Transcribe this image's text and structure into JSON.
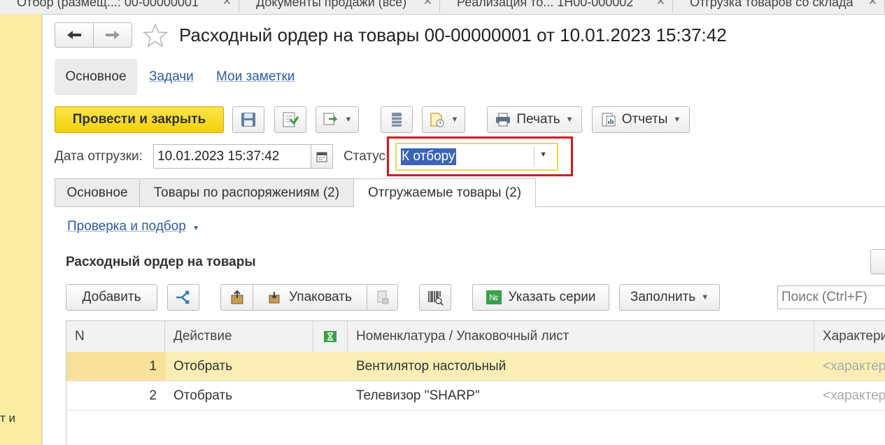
{
  "top_tabs": [
    {
      "label": "Отбор (размещ...: 00-00000001"
    },
    {
      "label": "Документы продажи (все)"
    },
    {
      "label": "Реализация то... 1Н00-000002"
    },
    {
      "label": "Отгрузка товаров со склада"
    }
  ],
  "left_panel": {
    "fragment": "т и"
  },
  "window": {
    "title": "Расходный ордер на товары 00-00000001 от 10.01.2023 15:37:42",
    "nav": {
      "back_icon": "arrow-left-icon",
      "forward_icon": "arrow-right-icon",
      "favorite_icon": "star-icon"
    }
  },
  "subnav": [
    {
      "label": "Основное",
      "active": true
    },
    {
      "label": "Задачи",
      "active": false
    },
    {
      "label": "Мои заметки",
      "active": false
    }
  ],
  "toolbar": {
    "post_close": "Провести и закрыть",
    "print": "Печать",
    "reports": "Отчеты",
    "accent_color": "#f8d90f"
  },
  "fields": {
    "ship_date_label": "Дата отгрузки:",
    "ship_date_value": "10.01.2023 15:37:42",
    "status_label": "Статус:",
    "status_value": "К отбору"
  },
  "doc_tabs": [
    {
      "label": "Основное"
    },
    {
      "label": "Товары по распоряжениям (2)"
    },
    {
      "label": "Отгружаемые товары (2)",
      "active": true
    }
  ],
  "check_link": "Проверка и подбор",
  "section_title": "Расходный ордер на товары",
  "table_toolbar": {
    "add": "Добавить",
    "pack": "Упаковать",
    "series_badge": "№",
    "series": "Указать серии",
    "fill": "Заполнить",
    "search_placeholder": "Поиск (Ctrl+F)"
  },
  "grid": {
    "columns": [
      "N",
      "Действие",
      "",
      "Номенклатура / Упаковочный лист",
      "Характеристика"
    ],
    "rows": [
      {
        "n": "1",
        "action": "Отобрать",
        "item": "Вентилятор настольный",
        "char": "<характеристики не используются>"
      },
      {
        "n": "2",
        "action": "Отобрать",
        "item": "Телевизор \"SHARP\"",
        "char": "<характеристики не используются>"
      }
    ]
  }
}
